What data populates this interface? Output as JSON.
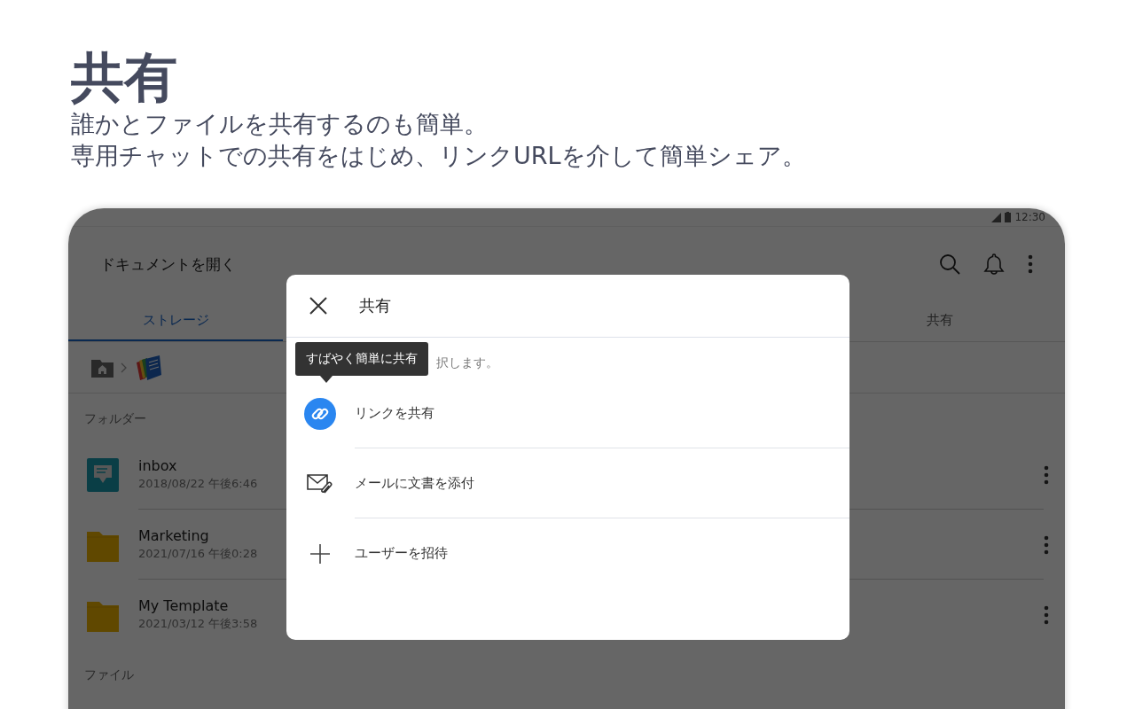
{
  "heading": {
    "title": "共有",
    "lines": [
      "誰かとファイルを共有するのも簡単。",
      "専用チャットでの共有をはじめ、リンクURLを介して簡単シェア。"
    ]
  },
  "status_bar": {
    "time": "12:30"
  },
  "app_bar": {
    "title": "ドキュメントを開く"
  },
  "tabs": [
    {
      "label": "ストレージ",
      "selected": true
    },
    {
      "label": "共有",
      "selected": false
    }
  ],
  "folders": {
    "title": "フォルダー",
    "items": [
      {
        "kind": "inbox",
        "name": "inbox",
        "date": "2018/08/22 午後6:46"
      },
      {
        "kind": "folder",
        "name": "Marketing",
        "date": "2021/07/16 午後0:28"
      },
      {
        "kind": "folder",
        "name": "My Template",
        "date": "2021/03/12 午後3:58"
      }
    ]
  },
  "files": {
    "title": "ファイル"
  },
  "dialog": {
    "title": "共有",
    "subtitle": "択します。",
    "tooltip": "すばやく簡単に共有",
    "options": [
      {
        "kind": "link",
        "label": "リンクを共有"
      },
      {
        "kind": "mail",
        "label": "メールに文書を添付"
      },
      {
        "kind": "invite",
        "label": "ユーザーを招待"
      }
    ]
  }
}
